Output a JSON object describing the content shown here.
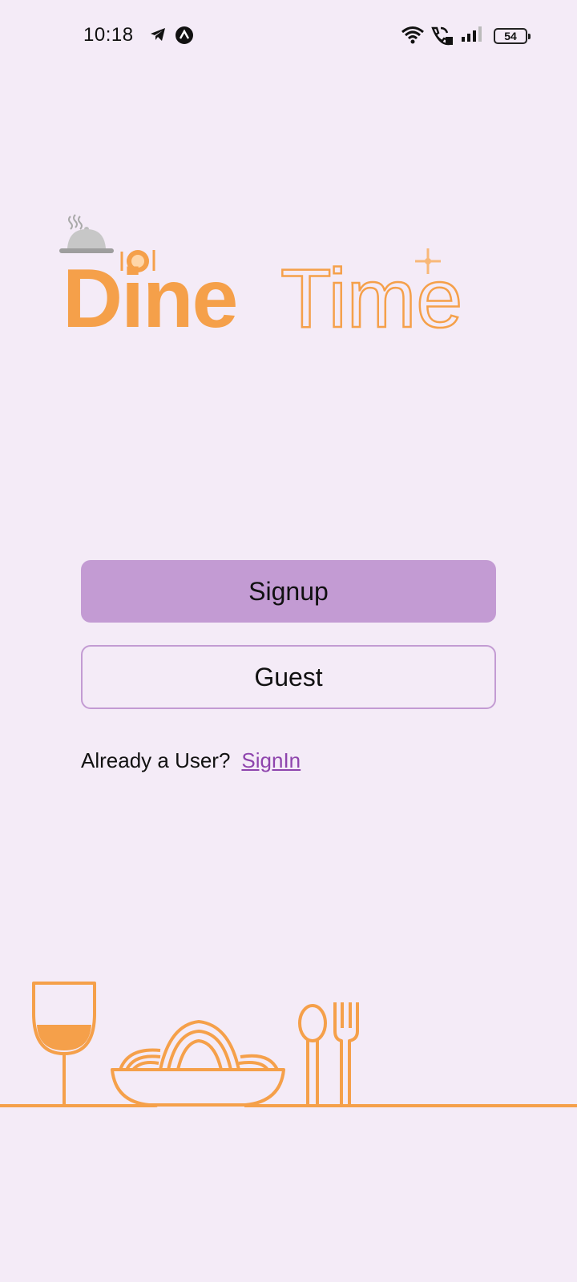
{
  "status_bar": {
    "time": "10:18",
    "battery_level": "54",
    "icons": [
      "telegram-icon",
      "app-notification-icon",
      "wifi-icon",
      "wifi-calling-icon",
      "signal-icon",
      "battery-icon"
    ]
  },
  "logo": {
    "word_bold": "Dine",
    "word_outline": "Time",
    "accent_color": "#f5a04a"
  },
  "actions": {
    "signup_label": "Signup",
    "guest_label": "Guest"
  },
  "signin": {
    "question": "Already a User?",
    "link_label": "SignIn"
  },
  "colors": {
    "background": "#f4ebf7",
    "primary_button": "#c39bd3",
    "link": "#8e44ad",
    "illustration": "#f5a04a"
  }
}
